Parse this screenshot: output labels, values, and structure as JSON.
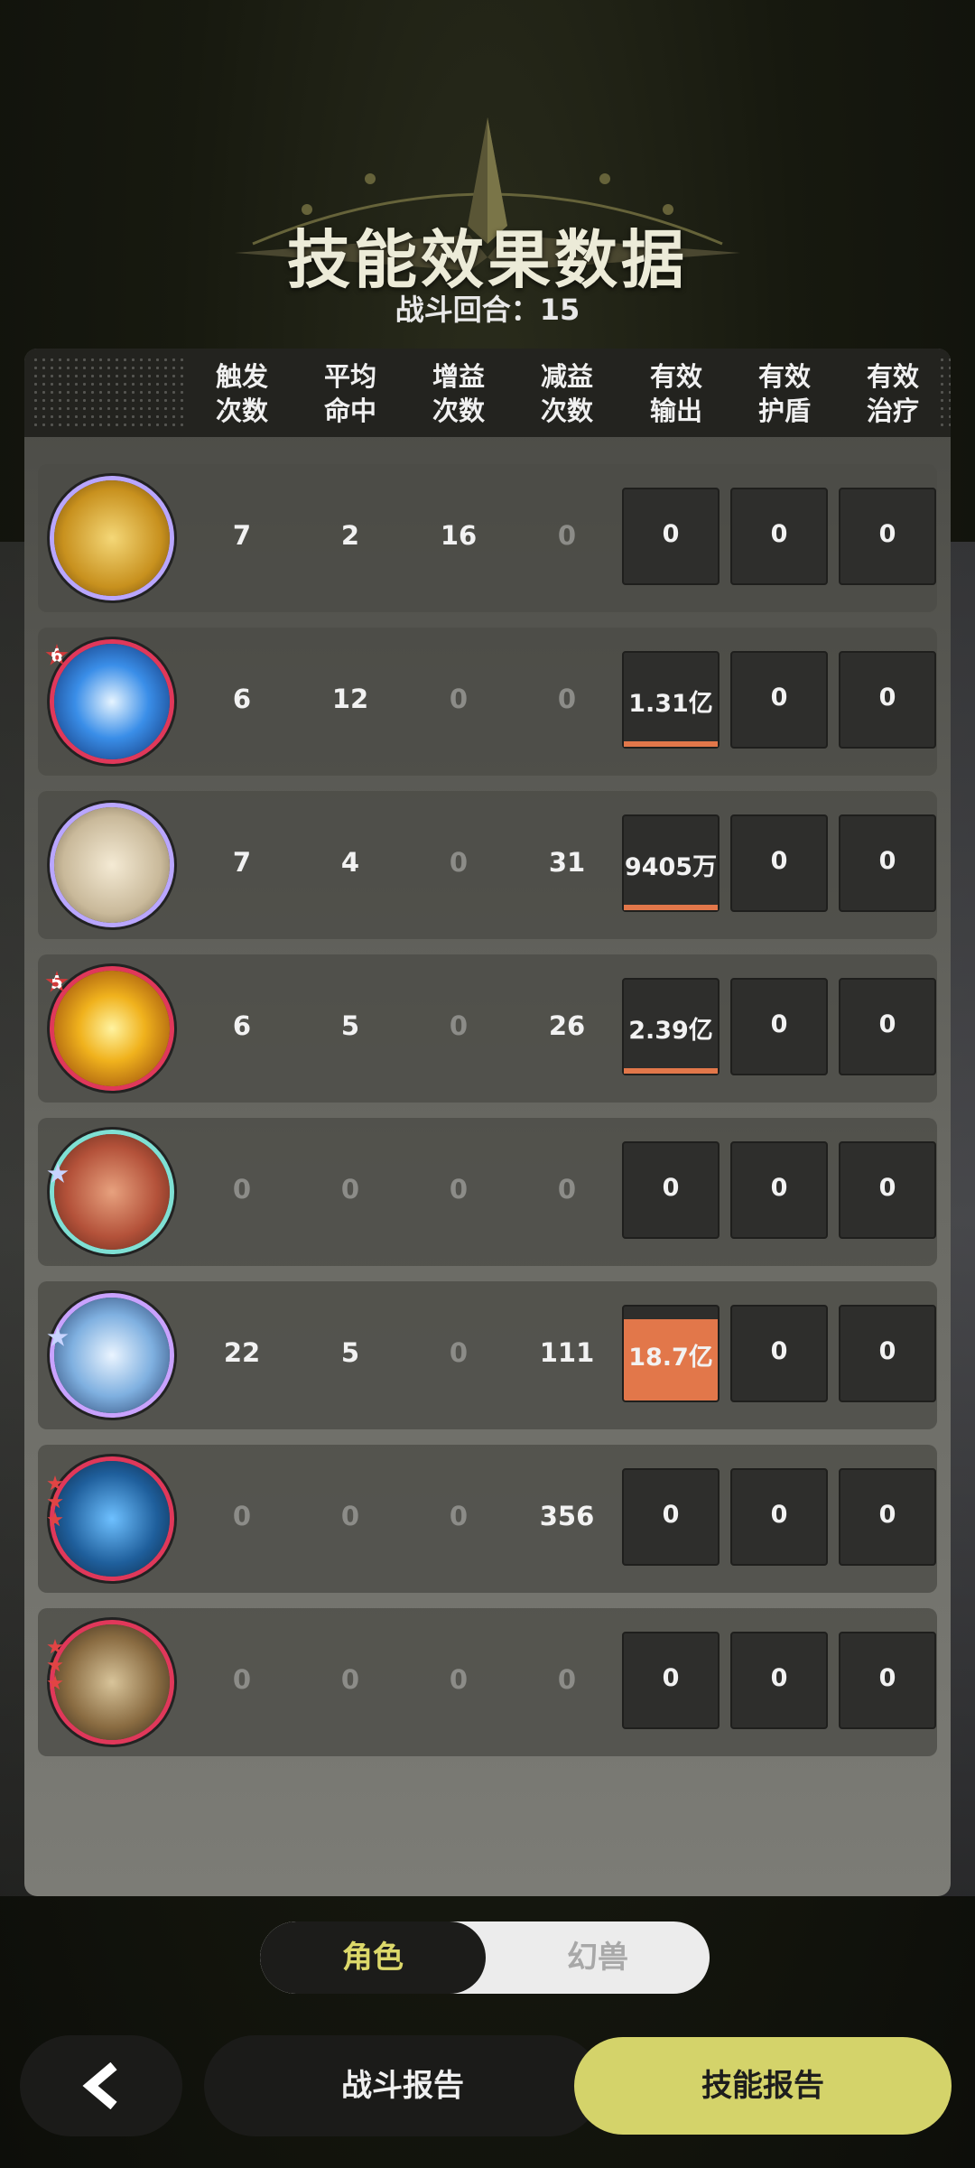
{
  "header": {
    "title": "技能效果数据",
    "round_text": "战斗回合：15"
  },
  "table": {
    "columns": [
      "触发\n次数",
      "平均\n命中",
      "增益\n次数",
      "减益\n次数",
      "有效\n输出",
      "有效\n护盾",
      "有效\n治疗"
    ],
    "rows": [
      {
        "icon": "gold-rune-icon",
        "badge": "",
        "trigger": "7",
        "avg_hit": "2",
        "buff": "16",
        "debuff": "0",
        "output": "0",
        "shield": "0",
        "heal": "0",
        "output_fraction": 0
      },
      {
        "icon": "blue-vortex-icon",
        "badge": "6",
        "trigger": "6",
        "avg_hit": "12",
        "buff": "0",
        "debuff": "0",
        "output": "1.31亿",
        "shield": "0",
        "heal": "0",
        "output_fraction": 1
      },
      {
        "icon": "pale-glyph-icon",
        "badge": "",
        "trigger": "7",
        "avg_hit": "4",
        "buff": "0",
        "debuff": "31",
        "output": "9405万",
        "shield": "0",
        "heal": "0",
        "output_fraction": 1
      },
      {
        "icon": "golden-burst-icon",
        "badge": "5",
        "trigger": "6",
        "avg_hit": "5",
        "buff": "0",
        "debuff": "26",
        "output": "2.39亿",
        "shield": "0",
        "heal": "0",
        "output_fraction": 1
      },
      {
        "icon": "shield-sword-icon",
        "badge": "star",
        "trigger": "0",
        "avg_hit": "0",
        "buff": "0",
        "debuff": "0",
        "output": "0",
        "shield": "0",
        "heal": "0",
        "output_fraction": 0
      },
      {
        "icon": "ice-shield-icon",
        "badge": "star",
        "trigger": "22",
        "avg_hit": "5",
        "buff": "0",
        "debuff": "111",
        "output": "18.7亿",
        "shield": "0",
        "heal": "0",
        "output_fraction": 1
      },
      {
        "icon": "snowflake-icon",
        "badge": "red-stars",
        "trigger": "0",
        "avg_hit": "0",
        "buff": "0",
        "debuff": "356",
        "output": "0",
        "shield": "0",
        "heal": "0",
        "output_fraction": 0
      },
      {
        "icon": "beast-claw-icon",
        "badge": "red-stars",
        "trigger": "0",
        "avg_hit": "0",
        "buff": "0",
        "debuff": "0",
        "output": "0",
        "shield": "0",
        "heal": "0",
        "output_fraction": 0
      }
    ]
  },
  "toggle": {
    "active": "角色",
    "inactive": "幻兽"
  },
  "nav": {
    "back_icon": "chevron-left-icon",
    "report_label": "战斗报告",
    "skill_label": "技能报告"
  },
  "colors": {
    "accent": "#d4d36a",
    "output_bar": "#e2774a",
    "active_tab_text": "#dcd86a"
  }
}
